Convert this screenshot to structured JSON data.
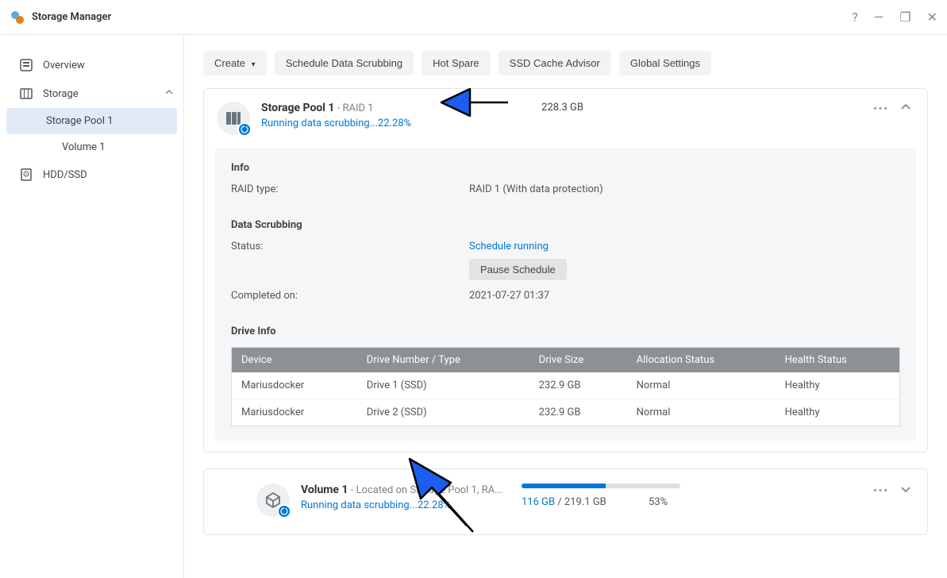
{
  "app_title": "Storage Manager",
  "sidebar": {
    "overview": "Overview",
    "storage": "Storage",
    "storage_pool_1": "Storage Pool 1",
    "volume_1": "Volume 1",
    "hdd_ssd": "HDD/SSD"
  },
  "toolbar": {
    "create": "Create",
    "schedule_scrubbing": "Schedule Data Scrubbing",
    "hot_spare": "Hot Spare",
    "ssd_cache": "SSD Cache Advisor",
    "global_settings": "Global Settings"
  },
  "pool": {
    "title": "Storage Pool 1",
    "raid_suffix": " - RAID 1",
    "status_prefix": "Running data scrubbing...",
    "status_pct": "22.28%",
    "size": "228.3 GB"
  },
  "info": {
    "section_title": "Info",
    "raid_type_label": "RAID type:",
    "raid_type_value": "RAID 1 (With data protection)",
    "scrub_title": "Data Scrubbing",
    "status_label": "Status:",
    "status_value": "Schedule running",
    "pause_btn": "Pause Schedule",
    "completed_label": "Completed on:",
    "completed_value": "2021-07-27 01:37",
    "drive_info_title": "Drive Info",
    "col_device": "Device",
    "col_drive": "Drive Number / Type",
    "col_size": "Drive Size",
    "col_alloc": "Allocation Status",
    "col_health": "Health Status",
    "drives": [
      {
        "device": "Mariusdocker",
        "num": "Drive 1 (SSD)",
        "size": "232.9 GB",
        "alloc": "Normal",
        "health": "Healthy"
      },
      {
        "device": "Mariusdocker",
        "num": "Drive 2 (SSD)",
        "size": "232.9 GB",
        "alloc": "Normal",
        "health": "Healthy"
      }
    ]
  },
  "volume": {
    "title": "Volume 1",
    "location": " - Located on Storage Pool 1, RA...",
    "status_prefix": "Running data scrubbing...",
    "status_pct": "22.28%",
    "used": "116 GB",
    "total": " / 219.1 GB",
    "pct": "53%",
    "progress_pct": 53
  }
}
